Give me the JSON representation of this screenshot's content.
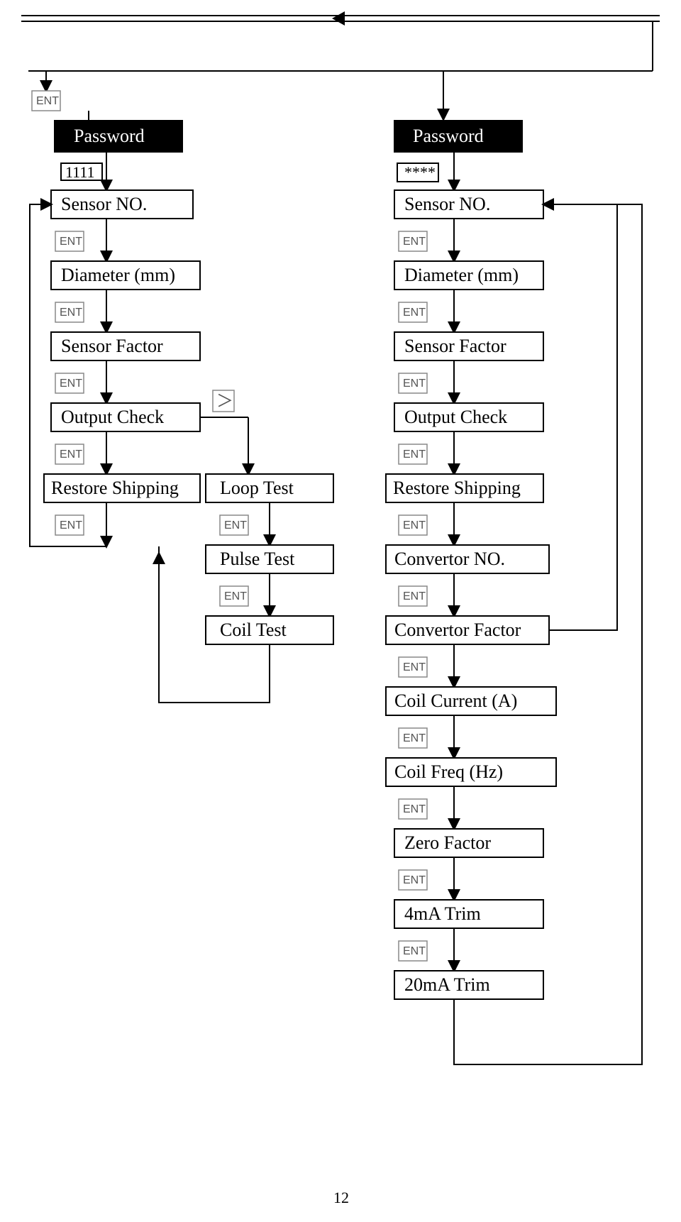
{
  "pageNumber": "12",
  "entLabel": "ENT",
  "gtSymbol": "＞",
  "left": {
    "password": "Password",
    "pwValue": "1111",
    "steps": [
      "Sensor   NO.",
      "Diameter (mm)",
      "Sensor   Factor",
      "Output   Check",
      "Restore Shipping"
    ],
    "branch": [
      "Loop    Test",
      "Pulse    Test",
      "Coil    Test"
    ]
  },
  "right": {
    "password": "Password",
    "pwValue": "****",
    "steps": [
      "Sensor   NO.",
      "Diameter (mm)",
      "Sensor   Factor",
      "Output   Check",
      "Restore Shipping",
      "Convertor   NO.",
      "Convertor  Factor",
      "Coil   Current (A)",
      "Coil   Freq (Hz)",
      "Zero   Factor",
      "4mA    Trim",
      "20mA   Trim"
    ]
  }
}
